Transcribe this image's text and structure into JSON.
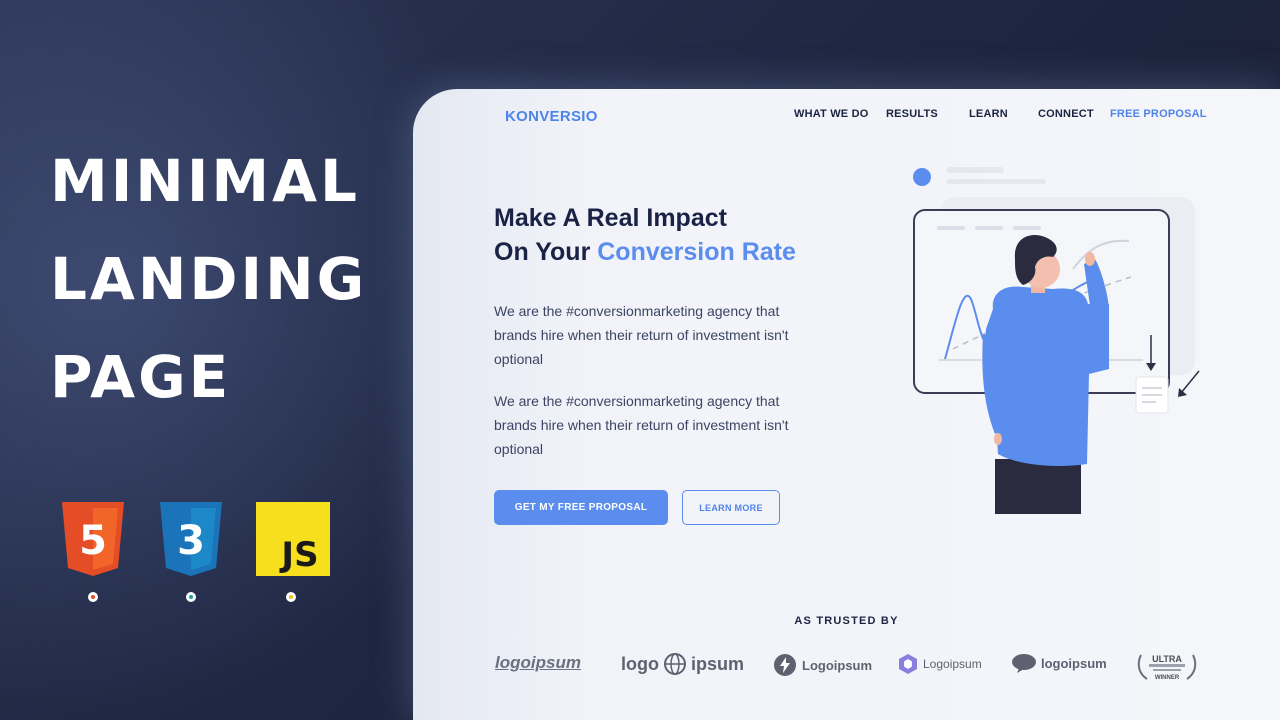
{
  "left": {
    "title_lines": [
      "MINIMAL",
      "LANDING",
      "PAGE"
    ],
    "tech": [
      {
        "icon": "html5-logo-icon",
        "label": "5",
        "color": "#e44d26",
        "dot_color": "#e44d26"
      },
      {
        "icon": "css3-logo-icon",
        "label": "3",
        "color": "#1b73ba",
        "dot_color": "#1ba3a3"
      },
      {
        "icon": "javascript-logo-icon",
        "label": "JS",
        "color": "#f7df1e",
        "dot_color": "#f0c020"
      }
    ]
  },
  "site": {
    "brand": "KONVERSIO",
    "nav": [
      "WHAT WE DO",
      "RESULTS",
      "LEARN",
      "CONNECT",
      "FREE PROPOSAL"
    ],
    "headline_line1": "Make A Real Impact",
    "headline_line2_prefix": "On Your ",
    "headline_line2_accent": "Conversion Rate",
    "paragraphs": [
      "We are the #conversionmarketing agency that brands hire when their return of investment isn't optional",
      "We are the #conversionmarketing agency that brands hire when their return of investment isn't optional"
    ],
    "primary_button": "GET MY FREE PROPOSAL",
    "secondary_button": "LEARN MORE",
    "trusted_label": "AS TRUSTED  BY",
    "logos": [
      "logoipsum",
      "logo",
      "ipsum",
      "Logoipsum",
      "Logoipsum",
      "logoipsum",
      "ULTRA",
      "WINNER"
    ],
    "accent_color": "#5b8dee"
  }
}
